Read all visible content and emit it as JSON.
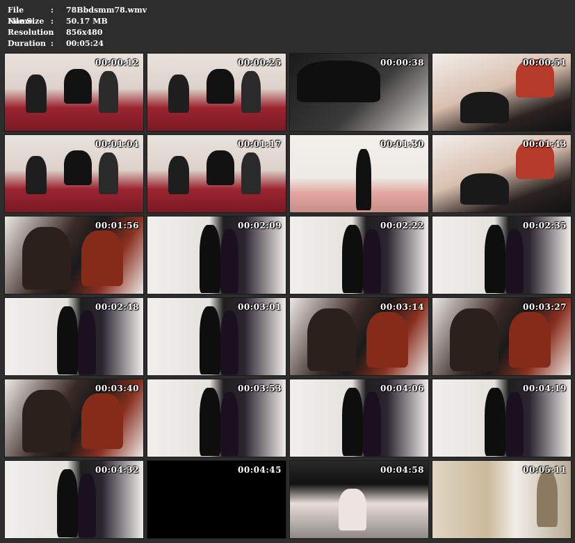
{
  "file_info": {
    "rows": [
      {
        "label": "File Name",
        "value": "78Bbdsmm78.wmv"
      },
      {
        "label": "File Size",
        "value": "50.17 MB"
      },
      {
        "label": "Resolution",
        "value": "856x480"
      },
      {
        "label": "Duration",
        "value": "00:05:24"
      }
    ],
    "separator": ":"
  },
  "thumbnails": [
    {
      "timestamp": "00:00:12",
      "scene": "room"
    },
    {
      "timestamp": "00:00:25",
      "scene": "room"
    },
    {
      "timestamp": "00:00:38",
      "scene": "dark"
    },
    {
      "timestamp": "00:00:51",
      "scene": "face"
    },
    {
      "timestamp": "00:01:04",
      "scene": "room"
    },
    {
      "timestamp": "00:01:17",
      "scene": "room"
    },
    {
      "timestamp": "00:01:30",
      "scene": "sofa"
    },
    {
      "timestamp": "00:01:43",
      "scene": "face"
    },
    {
      "timestamp": "00:01:56",
      "scene": "kiss"
    },
    {
      "timestamp": "00:02:09",
      "scene": "hall"
    },
    {
      "timestamp": "00:02:22",
      "scene": "hall"
    },
    {
      "timestamp": "00:02:35",
      "scene": "hall"
    },
    {
      "timestamp": "00:02:48",
      "scene": "hall"
    },
    {
      "timestamp": "00:03:01",
      "scene": "hall"
    },
    {
      "timestamp": "00:03:14",
      "scene": "kiss"
    },
    {
      "timestamp": "00:03:27",
      "scene": "kiss"
    },
    {
      "timestamp": "00:03:40",
      "scene": "kiss"
    },
    {
      "timestamp": "00:03:53",
      "scene": "hall"
    },
    {
      "timestamp": "00:04:06",
      "scene": "hall"
    },
    {
      "timestamp": "00:04:19",
      "scene": "hall"
    },
    {
      "timestamp": "00:04:32",
      "scene": "hall"
    },
    {
      "timestamp": "00:04:45",
      "scene": "black"
    },
    {
      "timestamp": "00:04:58",
      "scene": "legs"
    },
    {
      "timestamp": "00:05:11",
      "scene": "door"
    }
  ],
  "colors": {
    "background": "#2d2d2d",
    "text": "#ffffff"
  }
}
